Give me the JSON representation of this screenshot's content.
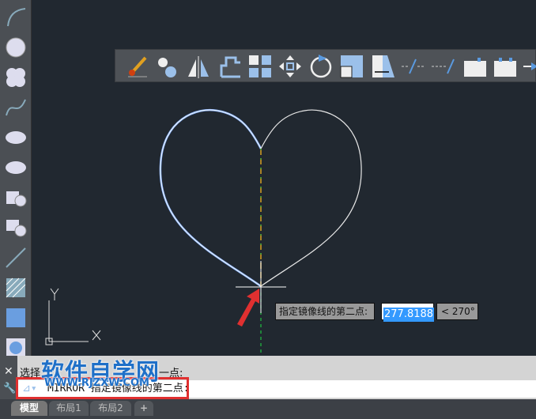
{
  "toolbar_top": {
    "icons": [
      "match-properties-icon",
      "copy-icon",
      "mirror-icon",
      "offset-icon",
      "array-icon",
      "move-icon",
      "rotate-icon",
      "scale-icon",
      "stretch-icon",
      "trim-icon",
      "extend-icon",
      "break-at-point-icon",
      "break-icon",
      "more-icon"
    ]
  },
  "toolbar_left": {
    "icons": [
      "arc-icon",
      "circle-icon",
      "revision-cloud-icon",
      "spline-icon",
      "ellipse-icon",
      "ellipse-arc-icon",
      "insert-block-icon",
      "make-block-icon",
      "point-icon",
      "hatch-icon",
      "gradient-icon",
      "region-icon"
    ]
  },
  "tooltip": {
    "prompt": "指定镜像线的第二点:",
    "value": "277.8188",
    "angle": "< 270°"
  },
  "command": {
    "history": "选择",
    "history_tail": "一点:",
    "current": "MIRROR 指定镜像线的第二点:"
  },
  "watermark": {
    "title": "软件自学网",
    "url": "WWW.RJZXW.COM"
  },
  "ucs": {
    "x": "X",
    "y": "Y"
  },
  "tabs": [
    {
      "label": "模型"
    },
    {
      "label": "布局1"
    },
    {
      "label": "布局2"
    },
    {
      "label": "+"
    }
  ],
  "colors": {
    "background": "#212830",
    "selected_curve": "#8fb8ff",
    "mirrored_curve": "#ffffff",
    "mirror_line": "#d8a020",
    "highlight": "#e03030"
  }
}
